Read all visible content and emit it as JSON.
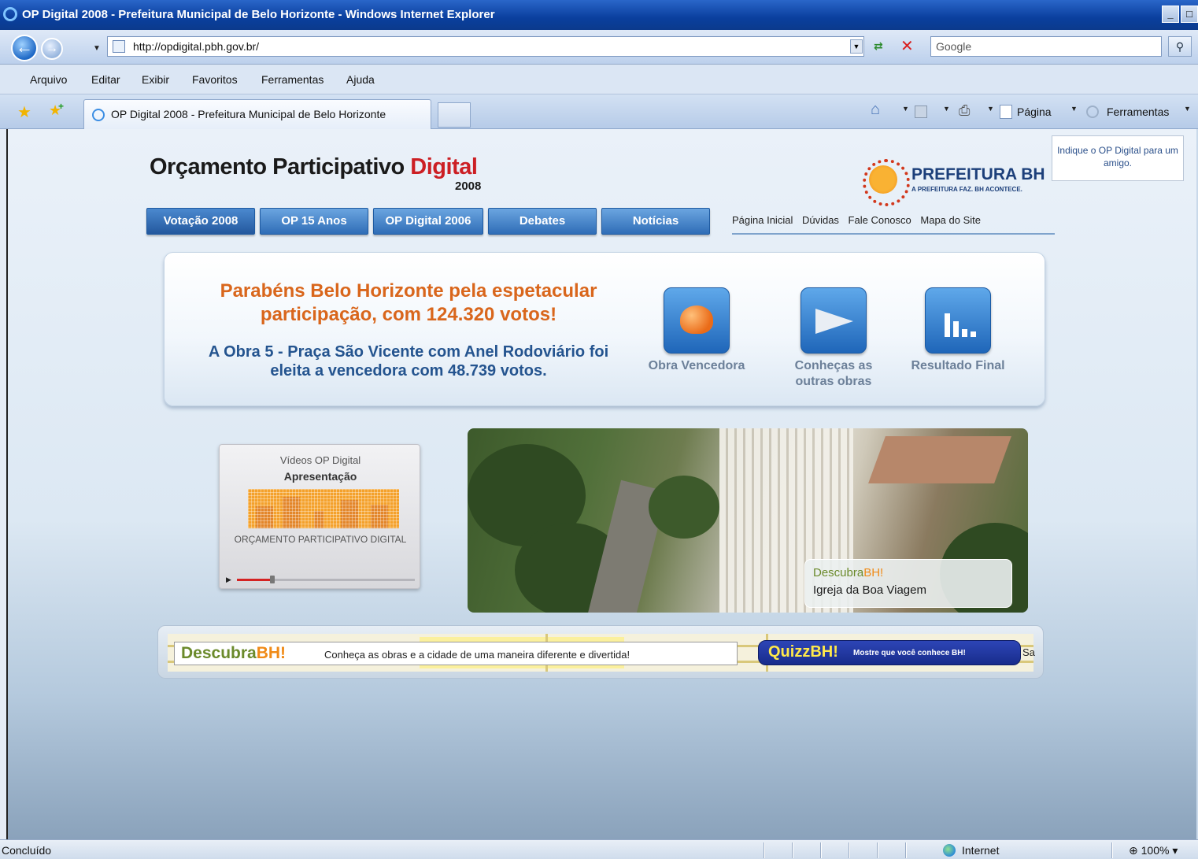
{
  "browser": {
    "window_title": "OP Digital 2008 - Prefeitura Municipal de Belo Horizonte - Windows Internet Explorer",
    "url": "http://opdigital.pbh.gov.br/",
    "search_placeholder": "Google",
    "menu": [
      "Arquivo",
      "Editar",
      "Exibir",
      "Favoritos",
      "Ferramentas",
      "Ajuda"
    ],
    "tab_title": "OP Digital 2008 - Prefeitura Municipal de Belo Horizonte",
    "cmd_page": "Página",
    "cmd_tools": "Ferramentas",
    "status_text": "Concluído",
    "status_zone": "Internet",
    "zoom": "100%"
  },
  "site": {
    "title_main": "Orçamento Participativo ",
    "title_accent": "Digital",
    "title_year": "2008",
    "brand_name": "PREFEITURA BH",
    "brand_tagline": "A PREFEITURA FAZ. BH ACONTECE.",
    "indique": "Indique o OP Digital para um amigo.",
    "tabs": [
      "Votação 2008",
      "OP 15 Anos",
      "OP Digital 2006",
      "Debates",
      "Notícias"
    ],
    "util_links": [
      "Página Inicial",
      "Dúvidas",
      "Fale Conosco",
      "Mapa do Site"
    ]
  },
  "hero": {
    "headline": "Parabéns Belo Horizonte pela espetacular participação, com 124.320 votos!",
    "sub": "A Obra 5 - Praça São Vicente com Anel Rodoviário foi eleita a vencedora com 48.739 votos.",
    "actions": [
      {
        "label": "Obra Vencedora",
        "icon": "helmet-icon"
      },
      {
        "label": "Conheças as outras obras",
        "icon": "plane-icon"
      },
      {
        "label": "Resultado Final",
        "icon": "bar-chart-icon"
      }
    ]
  },
  "video": {
    "title": "Vídeos OP Digital",
    "subtitle": "Apresentação",
    "caption": "ORÇAMENTO PARTICIPATIVO DIGITAL",
    "progress": 0.2
  },
  "photo": {
    "brand_a": "Descubra",
    "brand_b": "BH!",
    "place": "Igreja da Boa Viagem"
  },
  "banner": {
    "brand_a": "Descubra",
    "brand_b": "BH!",
    "text": "Conheça as obras e a cidade de uma maneira diferente e divertida!",
    "quizz_name": "QuizzBH!",
    "quizz_text": "Mostre que você conhece BH!",
    "map_label": "Sa"
  }
}
